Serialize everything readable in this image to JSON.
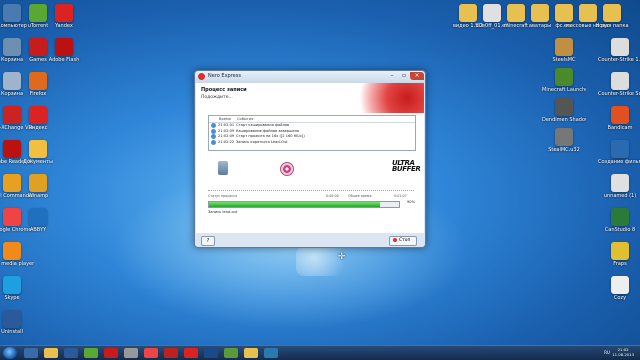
{
  "window": {
    "title": "Nero Express",
    "header_title": "Процесс записи",
    "header_subtitle": "Подождите...",
    "log_headers": [
      "Время",
      "События"
    ],
    "log_rows": [
      {
        "time": "21:02:01",
        "event": "Старт кэширования файлов"
      },
      {
        "time": "21:02:09",
        "event": "Кэширование файлов завершено"
      },
      {
        "time": "21:02:09",
        "event": "Старт прожига на 16x ([2 160 КБ/с])"
      },
      {
        "time": "21:02:22",
        "event": "Запись короткого Lead-Out"
      }
    ],
    "brand_line1": "ULTRA",
    "brand_line2": "BUFFER",
    "progress_label_left": "Статус процесса",
    "progress_label_mid": "0:00:00",
    "progress_label_total": "Общее время:",
    "progress_label_time": "0:01:07",
    "progress_value": 0.9,
    "progress_percent": "90%",
    "status_text": "Запись lead-out",
    "help_label": "?",
    "stop_label": "Стоп"
  },
  "taskbar": {
    "lang": "RU",
    "time": "21:02",
    "date": "11.08.2013"
  },
  "desktop_icons_left": [
    {
      "label": "Компьютер",
      "color": "#4a7bb0"
    },
    {
      "label": "Корзина",
      "color": "#6d8fb2"
    },
    {
      "label": "Корзина",
      "color": "#9db4cc"
    },
    {
      "label": "PDF-XChange Viewer",
      "color": "#c22"
    },
    {
      "label": "Adobe Reader XI",
      "color": "#b11"
    },
    {
      "label": "Total Commander",
      "color": "#e8a020"
    },
    {
      "label": "Google Chrome",
      "color": "#e44"
    },
    {
      "label": "VLC media player",
      "color": "#f08a1c"
    },
    {
      "label": "Skype",
      "color": "#1ea0e0"
    },
    {
      "label": "Uninstall",
      "color": "#2a5a9a"
    }
  ],
  "desktop_icons_col2": [
    {
      "label": "uTorrent",
      "color": "#5aa832"
    },
    {
      "label": "Games",
      "color": "#c81c1c"
    },
    {
      "label": "Firefox",
      "color": "#e06a1c"
    },
    {
      "label": "Яндекс",
      "color": "#d22"
    },
    {
      "label": "Документы",
      "color": "#f2c040"
    },
    {
      "label": "Winamp",
      "color": "#e0a020"
    },
    {
      "label": "ABBYY",
      "color": "#2070c0"
    }
  ],
  "desktop_icons_col3": [
    {
      "label": "Yandex",
      "color": "#d22"
    },
    {
      "label": "Adobe Flash",
      "color": "#b11"
    }
  ],
  "desktop_icons_top_right": [
    {
      "label": "видео 1.5.2",
      "color": "#e8c050"
    },
    {
      "label": "d0e0ff_01.elf",
      "color": "#e0e0e0"
    },
    {
      "label": "minecraft",
      "color": "#e8c050"
    },
    {
      "label": "аватары",
      "color": "#e8c050"
    },
    {
      "label": "фс.есс",
      "color": "#e8c050"
    },
    {
      "label": "массовые на рус",
      "color": "#e8c050"
    },
    {
      "label": "Новая папка",
      "color": "#e8c050"
    }
  ],
  "desktop_icons_right_col": [
    {
      "label": "Counter-Strike 1.6",
      "color": "#ddd"
    },
    {
      "label": "Counter-Strike Source",
      "color": "#ddd"
    },
    {
      "label": "Bandicam",
      "color": "#e05020"
    },
    {
      "label": "Создание фильма",
      "color": "#2a6ab0"
    },
    {
      "label": "unnamed (1)",
      "color": "#e0e0e0"
    },
    {
      "label": "CanStudio 8",
      "color": "#2a7a3a"
    },
    {
      "label": "Fraps",
      "color": "#e0c030"
    },
    {
      "label": "Cozy",
      "color": "#eee"
    }
  ],
  "desktop_icons_right_col2": [
    {
      "label": "SteelsMC",
      "color": "#c09040"
    },
    {
      "label": "Minecraft Launcher",
      "color": "#4a8a2a"
    },
    {
      "label": "Dendimen Shadow",
      "color": "#555"
    },
    {
      "label": "StealMC.u32",
      "color": "#777"
    }
  ]
}
